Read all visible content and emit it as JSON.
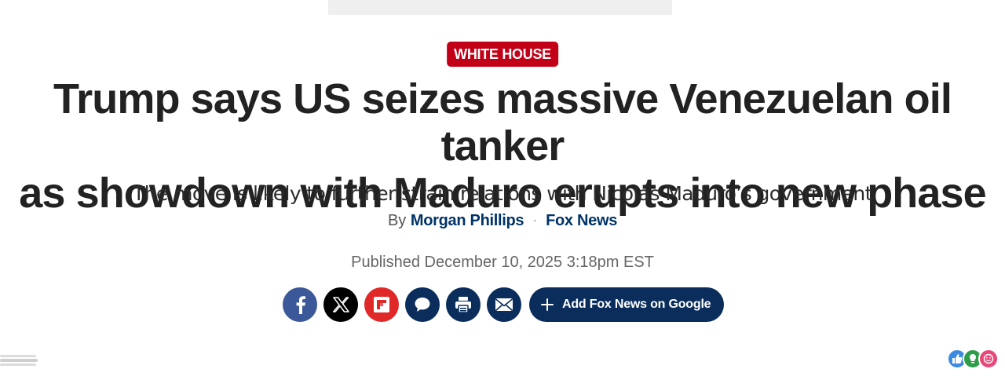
{
  "ad": {
    "placeholder": ""
  },
  "article": {
    "category": "WHITE HOUSE",
    "category_color": "#c20017",
    "headline_line1": "Trump says US seizes massive Venezuelan oil tanker",
    "headline_line2": "as showdown with Maduro erupts into new phase",
    "subheadline": "The move is likely to further strain relations with Nicolás Maduro’s government",
    "byline": {
      "prefix": "By",
      "author": "Morgan Phillips",
      "separator": "·",
      "source": "Fox News"
    },
    "published": "Published December 10, 2025 3:18pm EST"
  },
  "share": {
    "buttons": [
      {
        "name": "facebook",
        "icon": "facebook-icon",
        "color": "#3b5998"
      },
      {
        "name": "x",
        "icon": "x-icon",
        "color": "#000000"
      },
      {
        "name": "flipboard",
        "icon": "flipboard-icon",
        "color": "#e12828"
      },
      {
        "name": "comments",
        "icon": "comment-bubble-icon",
        "color": "#0a2d5c"
      },
      {
        "name": "print",
        "icon": "printer-icon",
        "color": "#0a2d5c"
      },
      {
        "name": "email",
        "icon": "envelope-icon",
        "color": "#0a2d5c"
      }
    ],
    "google_label": "Add Fox News on Google",
    "google_color": "#0a2d5c"
  },
  "reactions": [
    {
      "icon": "thumbs-up-icon",
      "color": "#3d8ae0"
    },
    {
      "icon": "lightbulb-icon",
      "color": "#2e9d4a"
    },
    {
      "icon": "heart-face-icon",
      "color": "#e8477a"
    }
  ]
}
